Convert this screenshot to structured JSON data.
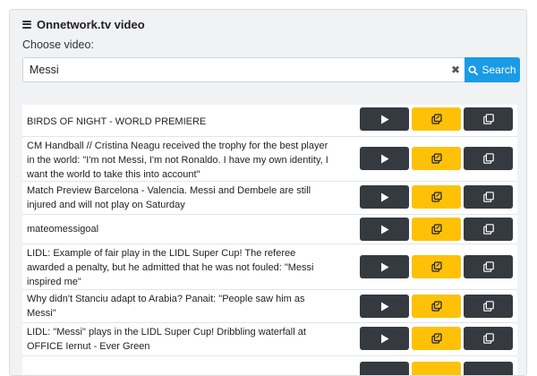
{
  "header": {
    "title": "Onnetwork.tv video",
    "icon": "hamburger-icon"
  },
  "search": {
    "label": "Choose video:",
    "value": "Messi",
    "button_label": "Search",
    "clear_icon": "close-icon"
  },
  "colors": {
    "play": "#343a40",
    "copy_link": "#ffc107",
    "copy": "#343a40",
    "search": "#1a9be6"
  },
  "results": [
    {
      "title": "BIRDS OF NIGHT - WORLD PREMIERE"
    },
    {
      "title": "CM Handball // Cristina Neagu received the trophy for the best player in the world: \"I'm not Messi, I'm not Ronaldo. I have my own identity, I want the world to take this into account\""
    },
    {
      "title": "Match Preview Barcelona - Valencia. Messi and Dembele are still injured and will not play on Saturday"
    },
    {
      "title": "mateomessigoal"
    },
    {
      "title": "LIDL: Example of fair play in the LIDL Super Cup! The referee awarded a penalty, but he admitted that he was not fouled: \"Messi inspired me\""
    },
    {
      "title": "Why didn't Stanciu adapt to Arabia? Panait: \"People saw him as Messi\""
    },
    {
      "title": "LIDL: \"Messi\" plays in the LIDL Super Cup! Dribbling waterfall at OFFICE Iernut - Ever Green"
    }
  ]
}
